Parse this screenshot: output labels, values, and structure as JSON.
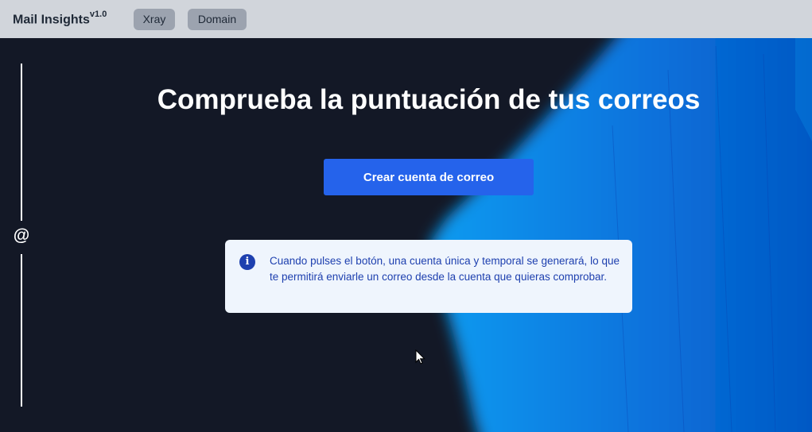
{
  "header": {
    "app_name": "Mail Insights",
    "version": "v1.0",
    "nav": [
      {
        "label": "Xray"
      },
      {
        "label": "Domain"
      }
    ]
  },
  "main": {
    "icon": "at-icon",
    "title": "Comprueba la puntuación de tus correos",
    "cta_label": "Crear cuenta de correo",
    "info": {
      "icon": "info-icon",
      "text": "Cuando pulses el botón, una cuenta única y temporal se generará, lo que te permitirá enviarle un correo desde la cuenta que quieras comprobar."
    }
  },
  "colors": {
    "header_bg": "#d1d5db",
    "page_bg": "#131826",
    "accent": "#2563eb",
    "info_bg": "#eff5fd",
    "info_text": "#1e40af"
  }
}
